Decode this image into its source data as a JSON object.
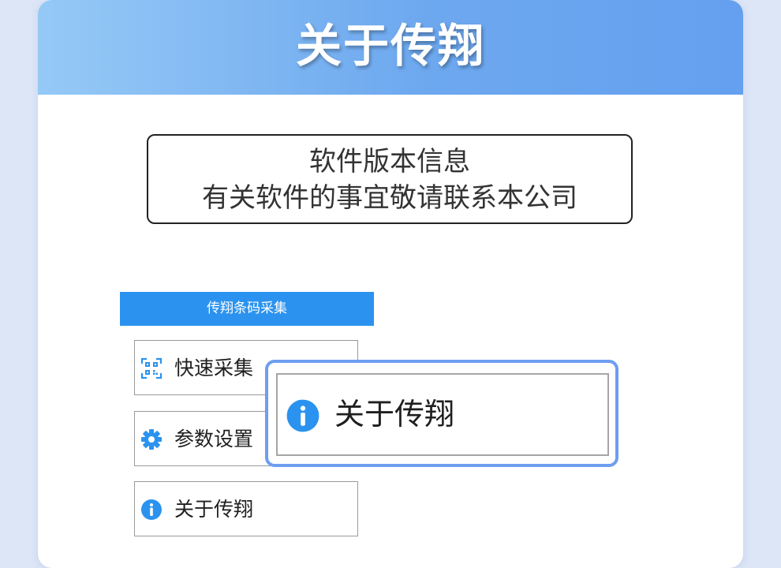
{
  "header": {
    "title": "关于传翔"
  },
  "info_box": {
    "line1": "软件版本信息",
    "line2": "有关软件的事宜敬请联系本公司"
  },
  "app_bar": {
    "title": "传翔条码采集"
  },
  "menu": [
    {
      "label": "快速采集",
      "icon": "qr-scan-icon"
    },
    {
      "label": "参数设置",
      "icon": "gear-icon"
    },
    {
      "label": "关于传翔",
      "icon": "info-icon"
    }
  ],
  "zoom_callout": {
    "label": "关于传翔",
    "icon": "info-icon"
  },
  "colors": {
    "background": "#dde6f7",
    "header_gradient_start": "#95c9f6",
    "header_gradient_end": "#64a0ef",
    "app_bar": "#2b93ef",
    "icon_blue": "#2b93ef",
    "zoom_border": "#6d9ef0"
  }
}
